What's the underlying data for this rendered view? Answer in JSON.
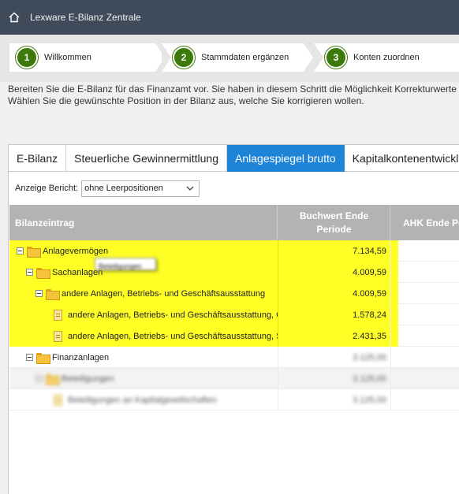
{
  "app": {
    "title": "Lexware E-Bilanz Zentrale"
  },
  "steps": [
    {
      "number": "1",
      "label": "Willkommen"
    },
    {
      "number": "2",
      "label": "Stammdaten ergänzen"
    },
    {
      "number": "3",
      "label": "Konten zuordnen"
    }
  ],
  "intro": {
    "line1": "Bereiten Sie die E-Bilanz für das Finanzamt vor. Sie haben in diesem Schritt die Möglichkeit Korrekturwerte an",
    "line2": "Wählen Sie die gewünschte Position in der Bilanz aus, welche Sie korrigieren wollen."
  },
  "tabs": [
    {
      "label": "E-Bilanz",
      "active": false
    },
    {
      "label": "Steuerliche Gewinnermittlung",
      "active": false
    },
    {
      "label": "Anlagespiegel brutto",
      "active": true
    },
    {
      "label": "Kapitalkontenentwicklu",
      "active": false
    }
  ],
  "report": {
    "label": "Anzeige Bericht:",
    "selected": "ohne Leerpositionen"
  },
  "grid": {
    "columns": {
      "bilanzeintrag": "Bilanzeintrag",
      "buchwert_line1": "Buchwert Ende",
      "buchwert_line2": "Periode",
      "ahk": "AHK Ende Pe"
    },
    "rows": [
      {
        "label": "Anlagevermögen",
        "value": "7.134,59"
      },
      {
        "label": "Sachanlagen",
        "value": "4.009,59"
      },
      {
        "label": "andere Anlagen, Betriebs- und Geschäftsausstattung",
        "value": "4.009,59"
      },
      {
        "label": "andere Anlagen, Betriebs- und Geschäftsausstattung, G",
        "value": "1.578,24"
      },
      {
        "label": "andere Anlagen, Betriebs- und Geschäftsausstattung, S",
        "value": "2.431,35"
      },
      {
        "label": "Finanzanlagen",
        "value": "3.125,00"
      },
      {
        "label": "Beteiligungen",
        "value": "3.125,00"
      },
      {
        "label": "Beteiligungen an Kapitalgesellschaften",
        "value": "3.125,00"
      }
    ]
  },
  "tooltip": {
    "text": "Beteiligungen"
  }
}
